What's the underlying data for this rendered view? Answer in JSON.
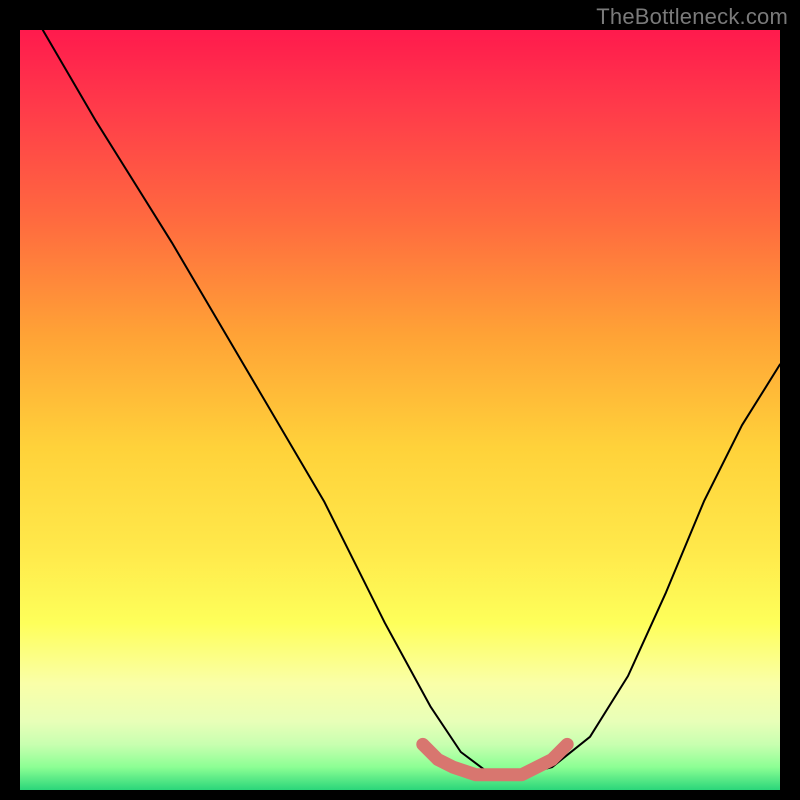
{
  "watermark": "TheBottleneck.com",
  "chart_data": {
    "type": "line",
    "title": "",
    "xlabel": "",
    "ylabel": "",
    "xlim": [
      0,
      100
    ],
    "ylim": [
      0,
      100
    ],
    "series": [
      {
        "name": "bottleneck-curve",
        "color": "#000000",
        "width": 2,
        "x": [
          3,
          10,
          20,
          30,
          40,
          48,
          54,
          58,
          62,
          66,
          70,
          75,
          80,
          85,
          90,
          95,
          100
        ],
        "y": [
          100,
          88,
          72,
          55,
          38,
          22,
          11,
          5,
          2,
          2,
          3,
          7,
          15,
          26,
          38,
          48,
          56
        ]
      },
      {
        "name": "optimal-band",
        "color": "#d8766f",
        "width": 13,
        "x": [
          53,
          55,
          57,
          60,
          63,
          66,
          68,
          70,
          72
        ],
        "y": [
          6,
          4,
          3,
          2,
          2,
          2,
          3,
          4,
          6
        ]
      }
    ],
    "gradient_stops": [
      {
        "pos": 0,
        "color": "#ff1a4d"
      },
      {
        "pos": 25,
        "color": "#ff6a3f"
      },
      {
        "pos": 55,
        "color": "#ffd23a"
      },
      {
        "pos": 78,
        "color": "#feff5a"
      },
      {
        "pos": 94,
        "color": "#c8ffb0"
      },
      {
        "pos": 100,
        "color": "#2bd67a"
      }
    ]
  }
}
